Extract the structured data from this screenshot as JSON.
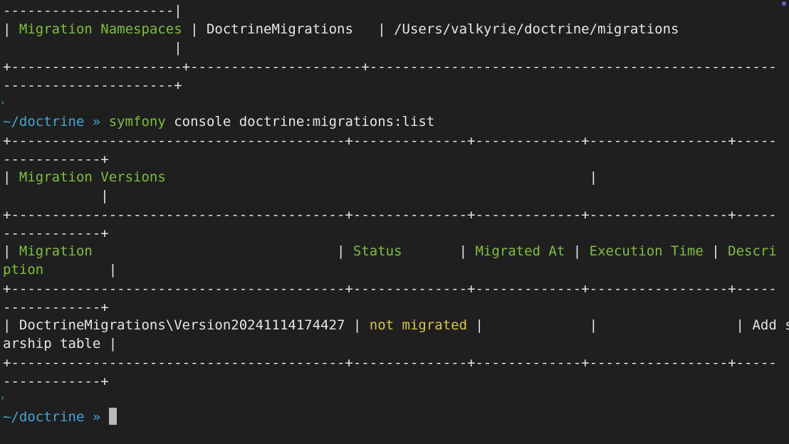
{
  "top": {
    "l1": "---------------------|",
    "l2_a": "| ",
    "l2_label": "Migration Namespaces",
    "l2_b": " | DoctrineMigrations   | /Users/valkyrie/doctrine/migrations",
    "l3": "                     |",
    "l4": "+---------------------+---------------------+--------------------------------------------------",
    "l5": "---------------------+"
  },
  "prompt1": {
    "path": "~/doctrine",
    "sep": " » ",
    "cmd": "symfony",
    "args": " console doctrine:migrations:list"
  },
  "table": {
    "border_a": "+-----------------------------------------+--------------+-------------+-----------------+-----",
    "border_b": "------------+",
    "title_pre": "| ",
    "title": "Migration Versions",
    "title_post": "                                                    |",
    "title_cont": "            |",
    "headers": {
      "migration": "Migration",
      "status": "Status",
      "migrated_at": "Migrated At",
      "execution_time": "Execution Time",
      "description_a": "Descri",
      "description_b": "ption"
    },
    "row": {
      "migration": "DoctrineMigrations\\Version20241114174427",
      "status": "not migrated",
      "description_a": "Add st",
      "description_b": "arship table"
    }
  },
  "prompt2": {
    "path": "~/doctrine",
    "sep": " » "
  }
}
